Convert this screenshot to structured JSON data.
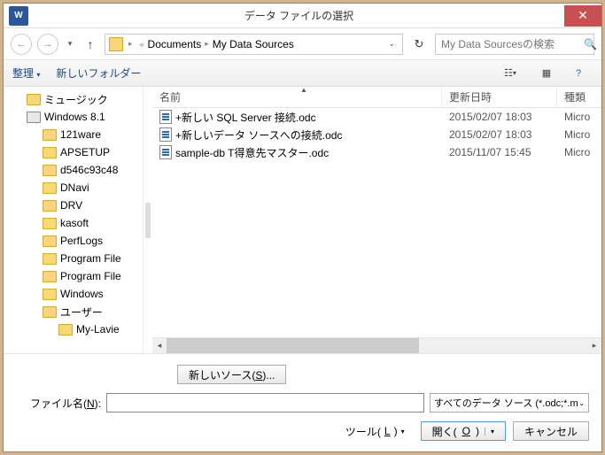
{
  "title": "データ ファイルの選択",
  "app_icon_letter": "W",
  "nav": {
    "breadcrumb": [
      "Documents",
      "My Data Sources"
    ],
    "search_placeholder": "My Data Sourcesの検索"
  },
  "toolbar": {
    "organize": "整理",
    "new_folder": "新しいフォルダー"
  },
  "tree": [
    {
      "label": "ミュージック",
      "level": 1,
      "icon": "folder"
    },
    {
      "label": "Windows 8.1",
      "level": 1,
      "icon": "drive"
    },
    {
      "label": "121ware",
      "level": 2,
      "icon": "folder"
    },
    {
      "label": "APSETUP",
      "level": 2,
      "icon": "folder"
    },
    {
      "label": "d546c93c48",
      "level": 2,
      "icon": "folder"
    },
    {
      "label": "DNavi",
      "level": 2,
      "icon": "folder"
    },
    {
      "label": "DRV",
      "level": 2,
      "icon": "folder"
    },
    {
      "label": "kasoft",
      "level": 2,
      "icon": "folder"
    },
    {
      "label": "PerfLogs",
      "level": 2,
      "icon": "folder"
    },
    {
      "label": "Program File",
      "level": 2,
      "icon": "folder"
    },
    {
      "label": "Program File",
      "level": 2,
      "icon": "folder"
    },
    {
      "label": "Windows",
      "level": 2,
      "icon": "folder"
    },
    {
      "label": "ユーザー",
      "level": 2,
      "icon": "folder"
    },
    {
      "label": "My-Lavie",
      "level": 3,
      "icon": "folder"
    }
  ],
  "columns": {
    "name": "名前",
    "date": "更新日時",
    "type": "種類"
  },
  "files": [
    {
      "name": "+新しい SQL Server 接続.odc",
      "date": "2015/02/07 18:03",
      "type": "Micro"
    },
    {
      "name": "+新しいデータ ソースへの接続.odc",
      "date": "2015/02/07 18:03",
      "type": "Micro"
    },
    {
      "name": "sample-db T得意先マスター.odc",
      "date": "2015/11/07 15:45",
      "type": "Micro"
    }
  ],
  "new_source_label": "新しいソース(S)...",
  "filename_label": "ファイル名(N):",
  "filetype_label": "すべてのデータ ソース (*.odc;*.m",
  "tool_label": "ツール(L)",
  "open_label": "開く(O)",
  "cancel_label": "キャンセル"
}
